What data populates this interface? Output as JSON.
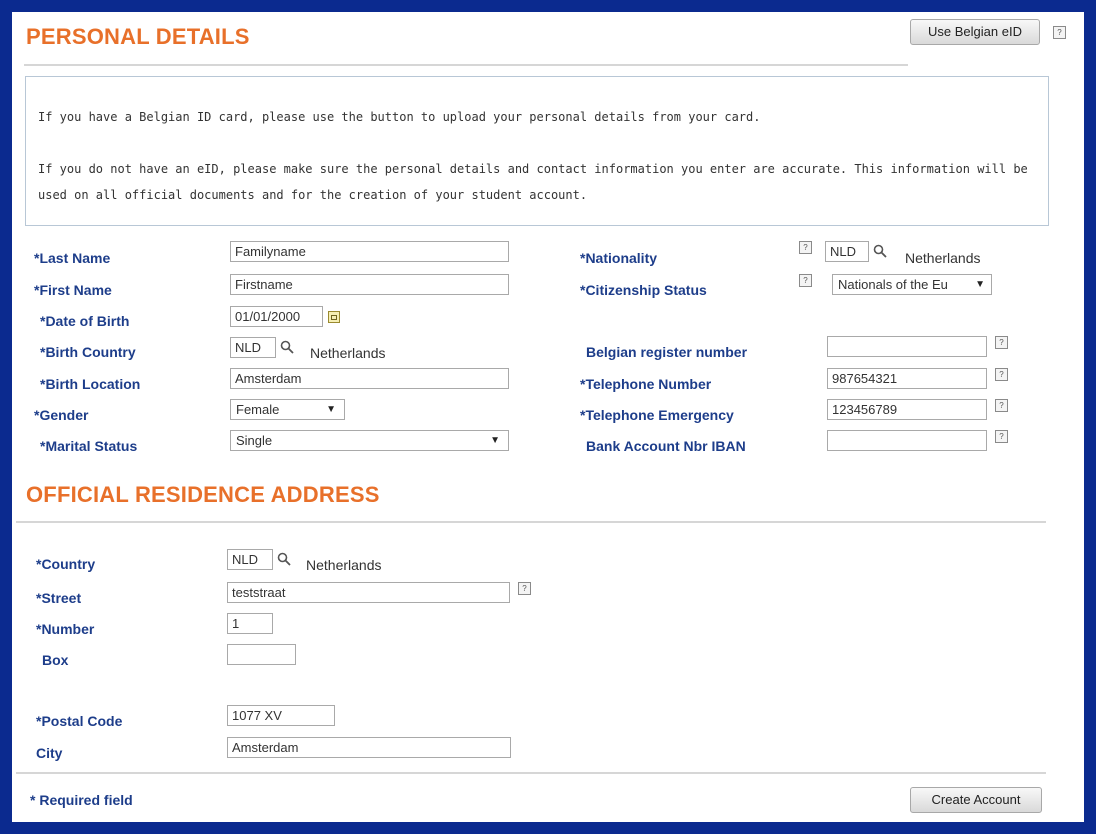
{
  "header": {
    "title": "PERSONAL DETAILS",
    "eid_button_label": "Use Belgian eID"
  },
  "info": {
    "line1": "If you have a Belgian ID card, please use the button to upload your personal details from your card.",
    "line2": "If you do not have an eID, please make sure the personal details and contact information you enter are accurate. This information will be used on all official documents and for the creation of your student account."
  },
  "personal": {
    "last_name_label": "*Last Name",
    "last_name_value": "Familyname",
    "first_name_label": "*First Name",
    "first_name_value": "Firstname",
    "dob_label": "*Date of Birth",
    "dob_value": "01/01/2000",
    "birth_country_label": "*Birth Country",
    "birth_country_code": "NLD",
    "birth_country_name": "Netherlands",
    "birth_location_label": "*Birth Location",
    "birth_location_value": "Amsterdam",
    "gender_label": "*Gender",
    "gender_value": "Female",
    "marital_label": "*Marital Status",
    "marital_value": "Single",
    "nationality_label": "*Nationality",
    "nationality_code": "NLD",
    "nationality_name": "Netherlands",
    "citizenship_label": "*Citizenship Status",
    "citizenship_value": "Nationals of the Eu",
    "register_label": "Belgian register number",
    "register_value": "",
    "phone_label": "*Telephone Number",
    "phone_value": "987654321",
    "emergency_label": "*Telephone Emergency",
    "emergency_value": "123456789",
    "iban_label": "Bank Account Nbr IBAN",
    "iban_value": ""
  },
  "address": {
    "title": "OFFICIAL RESIDENCE ADDRESS",
    "country_label": "*Country",
    "country_code": "NLD",
    "country_name": "Netherlands",
    "street_label": "*Street",
    "street_value": "teststraat",
    "number_label": "*Number",
    "number_value": "1",
    "box_label": "Box",
    "box_value": "",
    "postal_label": "*Postal Code",
    "postal_value": "1077 XV",
    "city_label": "City",
    "city_value": "Amsterdam"
  },
  "footer": {
    "required_note": "* Required field",
    "create_button_label": "Create Account"
  },
  "icons": {
    "help": "?",
    "dropdown": "▼"
  }
}
